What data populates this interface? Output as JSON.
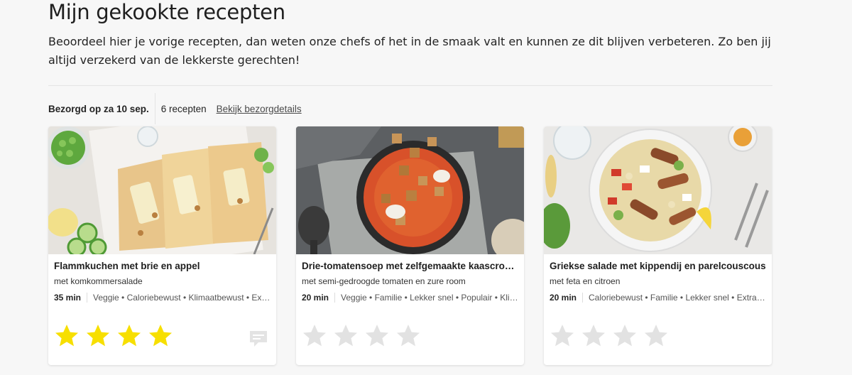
{
  "page": {
    "title": "Mijn gekookte recepten",
    "intro": "Beoordeel hier je vorige recepten, dan weten onze chefs of het in de smaak valt en kunnen ze dit blijven verbeteren. Zo ben jij altijd verzekerd van de lekkerste gerechten!"
  },
  "delivery": {
    "date_label": "Bezorgd op za 10 sep.",
    "count_label": "6 recepten",
    "details_link": "Bekijk bezorgdetails"
  },
  "colors": {
    "star_filled": "#f7df00",
    "star_empty": "#e2e2e2"
  },
  "recipes": [
    {
      "title": "Flammkuchen met brie en appel",
      "subtitle": "met komkommersalade",
      "time": "35 min",
      "tags": "Veggie • Caloriebewust • Klimaatbewust • Extra",
      "rating": 4,
      "max_rating": 4,
      "has_comment_icon": true
    },
    {
      "title": "Drie-tomatensoep met zelfgemaakte kaascroutons",
      "subtitle": "met semi-gedroogde tomaten en zure room",
      "time": "20 min",
      "tags": "Veggie • Familie • Lekker snel • Populair • Klimaatbewust",
      "rating": 0,
      "max_rating": 4,
      "has_comment_icon": false
    },
    {
      "title": "Griekse salade met kippendij en parelcouscous",
      "subtitle": "met feta en citroen",
      "time": "20 min",
      "tags": "Caloriebewust • Familie • Lekker snel • Extra groenten",
      "rating": 0,
      "max_rating": 4,
      "has_comment_icon": false
    }
  ]
}
